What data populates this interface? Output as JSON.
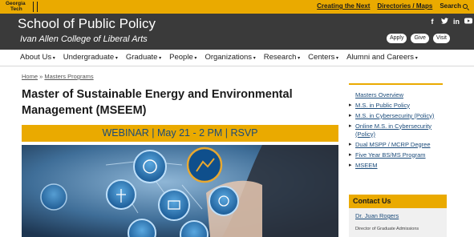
{
  "topbar": {
    "logo_line1": "Georgia",
    "logo_line2": "Tech",
    "links": [
      "Creating the Next",
      "Directories / Maps",
      "Search"
    ]
  },
  "header": {
    "title": "School of Public Policy",
    "subtitle": "Ivan Allen College of Liberal Arts",
    "social_icons": [
      "facebook-icon",
      "twitter-icon",
      "linkedin-icon",
      "youtube-icon"
    ],
    "buttons": [
      "Apply",
      "Give",
      "Visit"
    ]
  },
  "nav": {
    "items": [
      "About Us",
      "Undergraduate",
      "Graduate",
      "People",
      "Organizations",
      "Research",
      "Centers",
      "Alumni and Careers"
    ]
  },
  "breadcrumb": {
    "home": "Home",
    "separator": "»",
    "current": "Masters Programs"
  },
  "main": {
    "title": "Master of Sustainable Energy and Environmental Management (MSEEM)",
    "banner": "WEBINAR | May 21 - 2 PM | RSVP"
  },
  "sidebar": {
    "items": [
      {
        "label": "Masters Overview",
        "sub": false
      },
      {
        "label": "M.S. in Public Policy",
        "sub": true
      },
      {
        "label": "M.S. in Cybersecurity (Policy)",
        "sub": true
      },
      {
        "label": "Online M.S. in Cybersecurity (Policy)",
        "sub": true
      },
      {
        "label": "Dual MSPP / MCRP Degree",
        "sub": true
      },
      {
        "label": "Five Year BS/MS Program",
        "sub": true
      },
      {
        "label": "MSEEM",
        "sub": true
      }
    ],
    "contact_heading": "Contact Us",
    "contact_name": "Dr. Juan Rogers",
    "contact_role": "Director of Graduate Admissions"
  },
  "colors": {
    "gold": "#eaaa00",
    "header_dark": "#3a3a3a",
    "link_blue": "#1b4b7a"
  }
}
